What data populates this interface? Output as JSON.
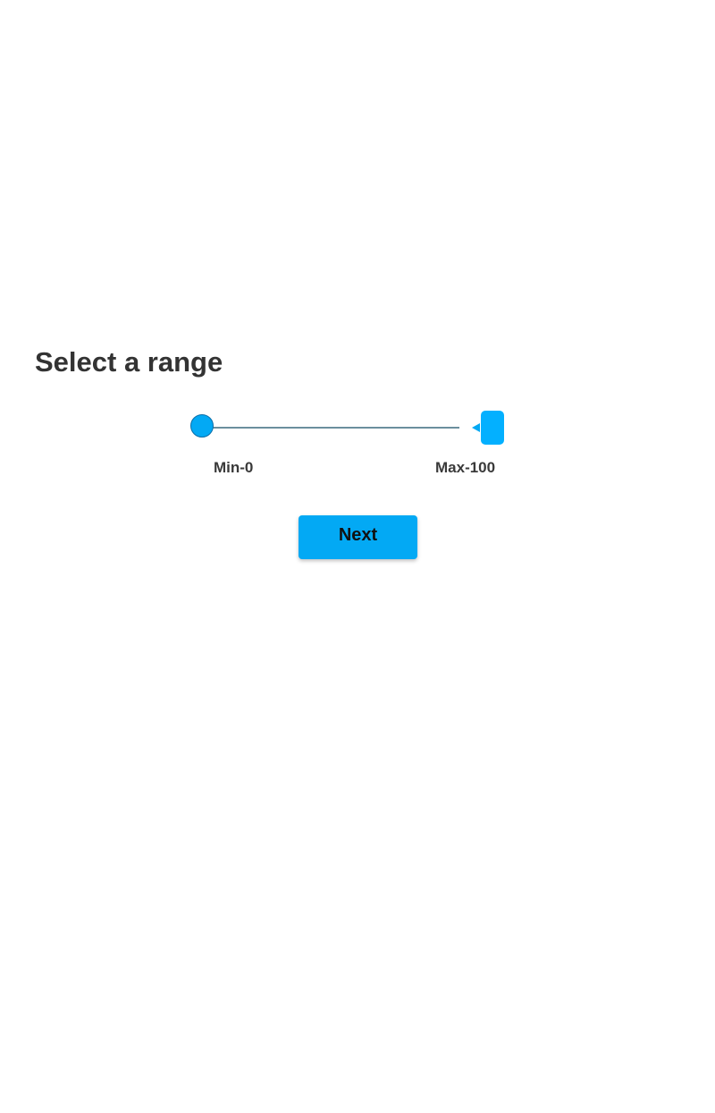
{
  "page": {
    "title": "Select a range"
  },
  "range": {
    "min_label": "Min-0",
    "max_label": "Max-100",
    "min_value": 0,
    "max_value": 100
  },
  "actions": {
    "next_label": "Next"
  },
  "colors": {
    "accent": "#03a9f4",
    "track": "#6b8f9e",
    "text": "#333333",
    "background": "#ffffff"
  }
}
